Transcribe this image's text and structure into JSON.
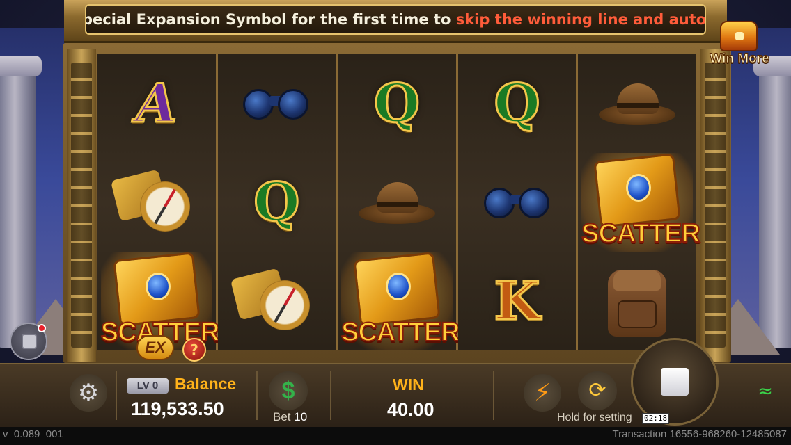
{
  "ticker": {
    "prefix": "pecial Expansion Symbol for the first time to ",
    "highlight": "skip the winning line and automat"
  },
  "win_more": {
    "label": "Win More",
    "icon": "treasure-chest-icon"
  },
  "reels": [
    [
      "A",
      "compass",
      "scatter"
    ],
    [
      "binoculars",
      "Q",
      "compass"
    ],
    [
      "Q",
      "hat",
      "scatter"
    ],
    [
      "Q",
      "binoculars",
      "K"
    ],
    [
      "hat",
      "scatter",
      "backpack"
    ]
  ],
  "symbols": {
    "scatter_word": "SCATTER",
    "ex_badge": "EX",
    "help_badge": "?"
  },
  "controls": {
    "settings_icon": "gear-icon",
    "level_badge": "LV 0",
    "balance_label": "Balance",
    "balance_value": "119,533.50",
    "bet_icon": "$",
    "bet_label": "Bet",
    "bet_value": "10",
    "win_label": "WIN",
    "win_value": "40.00",
    "turbo_icon": "lightning-icon",
    "autoplay_icon": "autoplay-icon",
    "hold_text": "Hold for setting",
    "spin_icon": "stop-icon",
    "wifi_icon": "wifi-icon"
  },
  "timer": "02:18",
  "footer": {
    "version": "v_0.089_001",
    "transaction": "Transaction 16556-968260-12485087"
  },
  "colors": {
    "accent_gold": "#ffb21a",
    "ticker_highlight": "#ff5c3a",
    "wifi_green": "#3ad34a"
  }
}
